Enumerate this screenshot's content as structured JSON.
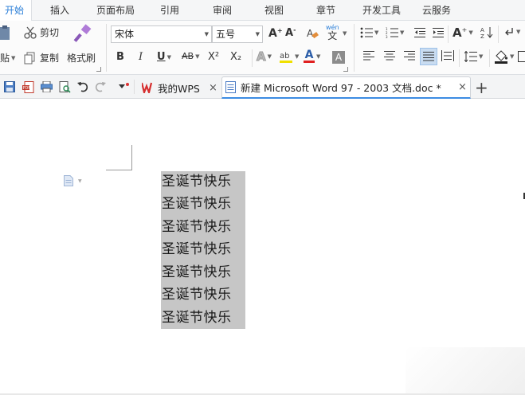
{
  "menu": {
    "tabs": [
      "开始",
      "插入",
      "页面布局",
      "引用",
      "审阅",
      "视图",
      "章节",
      "开发工具",
      "云服务"
    ],
    "active": "开始"
  },
  "ribbon": {
    "paste_label": "贴",
    "cut_label": "剪切",
    "copy_label": "复制",
    "format_painter_label": "格式刷",
    "font_name": "宋体",
    "font_size": "五号",
    "bold": "B",
    "italic": "I",
    "underline": "U",
    "strikethrough": "AB",
    "superscript": "X²",
    "subscript": "X₂",
    "pinyin_top": "wén",
    "pinyin_bottom": "文",
    "increase_font": "A",
    "decrease_font": "A",
    "text_effect": "A",
    "font_color": "A",
    "char_shade": "A",
    "bigger_a": "A",
    "accent_color": "#2b7fd8",
    "font_color_hex": "#e02020",
    "highlight_hex": "#f0e000"
  },
  "tabs_bar": {
    "wps_tab": "我的WPS",
    "doc_tab": "新建 Microsoft Word 97 - 2003 文档.doc *",
    "close": "×",
    "add": "+"
  },
  "document": {
    "lines": [
      "圣诞节快乐",
      "圣诞节快乐",
      "圣诞节快乐",
      "圣诞节快乐",
      "圣诞节快乐",
      "圣诞节快乐",
      "圣诞节快乐"
    ],
    "selection_color": "#c6c6c6"
  }
}
